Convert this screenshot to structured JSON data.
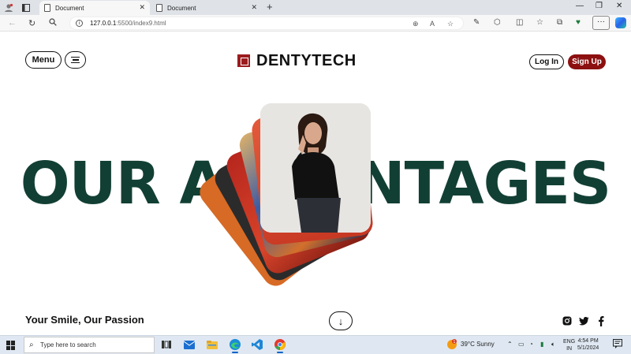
{
  "browser": {
    "tabs": [
      {
        "title": "Document",
        "active": true
      },
      {
        "title": "Document",
        "active": false
      }
    ],
    "url_host": "127.0.0.1",
    "url_rest": ":5500/index9.html",
    "new_tab": "+",
    "window_controls": {
      "minimize": "—",
      "maximize": "❐",
      "close": "✕"
    },
    "more": "···"
  },
  "site": {
    "menu_label": "Menu",
    "brand": "DENTYTECH",
    "login_label": "Log In",
    "signup_label": "Sign Up",
    "headline": "OUR ADVANTAGES",
    "tagline": "Your Smile, Our Passion",
    "down_arrow": "↓",
    "social": [
      "instagram-icon",
      "twitter-icon",
      "facebook-icon"
    ],
    "colors": {
      "brand": "#8c1010",
      "headline": "#123f34"
    }
  },
  "taskbar": {
    "search_placeholder": "Type here to search",
    "weather": "39°C  Sunny",
    "lang_top": "ENG",
    "lang_bottom": "IN",
    "time": "4:54 PM",
    "date": "5/1/2024",
    "weather_badge": "1"
  }
}
